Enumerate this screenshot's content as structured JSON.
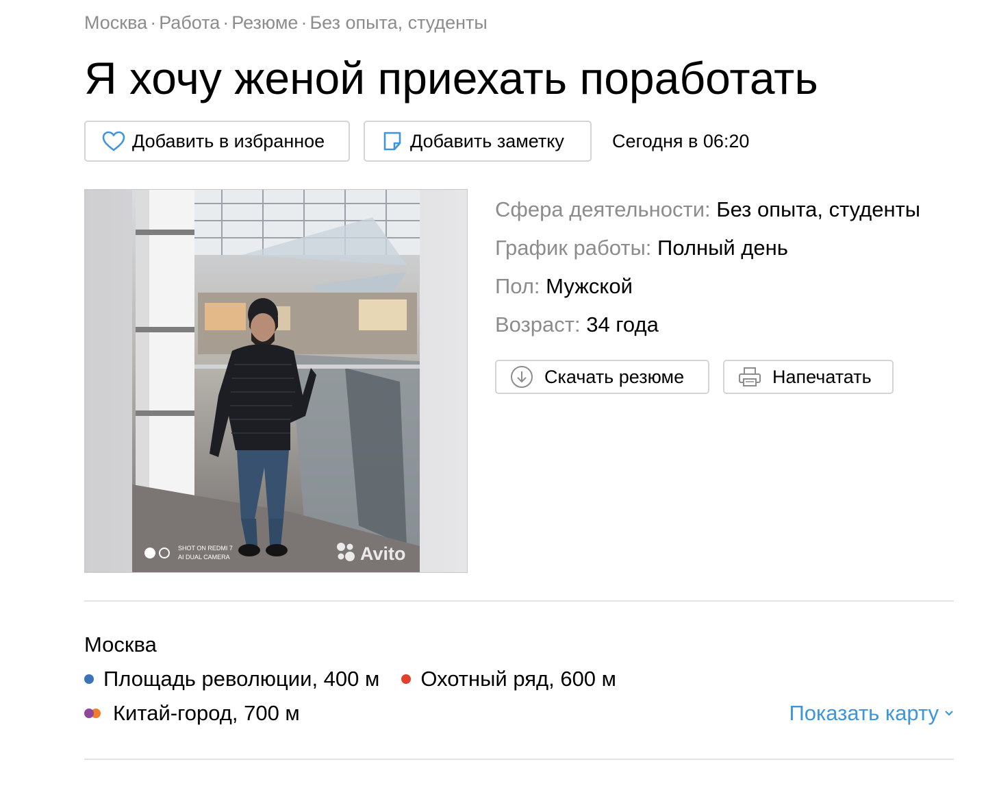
{
  "breadcrumb": {
    "items": [
      "Москва",
      "Работа",
      "Резюме",
      "Без опыта, студенты"
    ],
    "separator": "·"
  },
  "title": "Я хочу женой приехать поработать",
  "actions": {
    "favorite_label": "Добавить в избранное",
    "note_label": "Добавить заметку",
    "date": "Сегодня в 06:20"
  },
  "photo": {
    "watermark": "Avito",
    "camera_caption": [
      "SHOT ON REDMI 7",
      "AI DUAL CAMERA"
    ]
  },
  "params": [
    {
      "key": "Сфера деятельности:",
      "value": "Без опыта, студенты"
    },
    {
      "key": "График работы:",
      "value": "Полный день"
    },
    {
      "key": "Пол:",
      "value": "Мужской"
    },
    {
      "key": "Возраст:",
      "value": "34 года"
    }
  ],
  "resume_actions": {
    "download_label": "Скачать резюме",
    "print_label": "Напечатать"
  },
  "location": {
    "city": "Москва",
    "metro": [
      {
        "name": "Площадь революции, 400 м",
        "colors": [
          "#3b73b9"
        ]
      },
      {
        "name": "Охотный ряд, 600 м",
        "colors": [
          "#e0402c"
        ]
      },
      {
        "name": "Китай-город, 700 м",
        "colors": [
          "#8e479c",
          "#f07e2a"
        ]
      }
    ],
    "show_map_label": "Показать карту"
  },
  "colors": {
    "link": "#3d95e0",
    "muted": "#8c8c8c",
    "border": "#d4d4d4",
    "icon_blue": "#3d95e0"
  }
}
